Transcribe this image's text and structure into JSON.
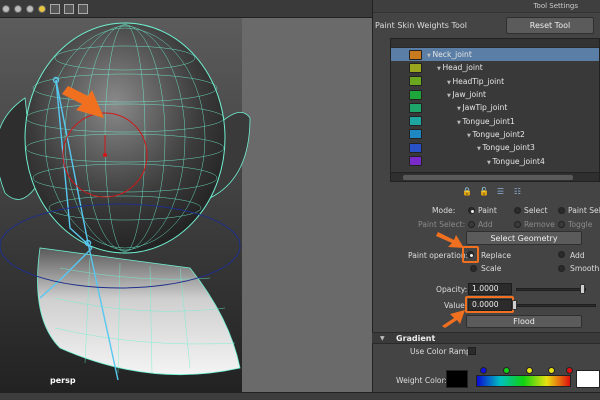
{
  "viewport": {
    "camera_label": "persp"
  },
  "panel": {
    "title": "Tool Settings",
    "tool_name": "Paint Skin Weights Tool",
    "reset_label": "Reset Tool"
  },
  "joints": [
    {
      "name": "Neck_joint",
      "color": "#c87a1e",
      "selected": true
    },
    {
      "name": "Head_joint",
      "color": "#9aa61e",
      "selected": false
    },
    {
      "name": "HeadTip_joint",
      "color": "#6aa61e",
      "selected": false
    },
    {
      "name": "Jaw_joint",
      "color": "#1ea63a",
      "selected": false
    },
    {
      "name": "JawTip_joint",
      "color": "#1ea66a",
      "selected": false
    },
    {
      "name": "Tongue_joint1",
      "color": "#1ea6a0",
      "selected": false
    },
    {
      "name": "Tongue_joint2",
      "color": "#1e86c0",
      "selected": false
    },
    {
      "name": "Tongue_joint3",
      "color": "#2a52c8",
      "selected": false
    },
    {
      "name": "Tongue_joint4",
      "color": "#7a2ac8",
      "selected": false
    }
  ],
  "mode": {
    "label": "Mode:",
    "options": [
      "Paint",
      "Select",
      "Paint Select"
    ],
    "selected": "Paint"
  },
  "paint_select": {
    "label": "Paint Select:",
    "options": [
      "Add",
      "Remove",
      "Toggle"
    ]
  },
  "select_geometry_label": "Select Geometry",
  "paint_operation": {
    "label": "Paint operation:",
    "options": [
      "Replace",
      "Add",
      "Scale",
      "Smooth"
    ],
    "selected": "Replace"
  },
  "opacity": {
    "label": "Opacity:",
    "value": "1.0000"
  },
  "value": {
    "label": "Value:",
    "value": "0.0000"
  },
  "flood_label": "Flood",
  "gradient": {
    "header": "Gradient",
    "use_color_ramp_label": "Use Color Ramp",
    "weight_color_label": "Weight Color:"
  },
  "colors": {
    "highlight": "#f07020",
    "wire": "#6ff0d0",
    "selected_row": "#5a7ea6"
  }
}
